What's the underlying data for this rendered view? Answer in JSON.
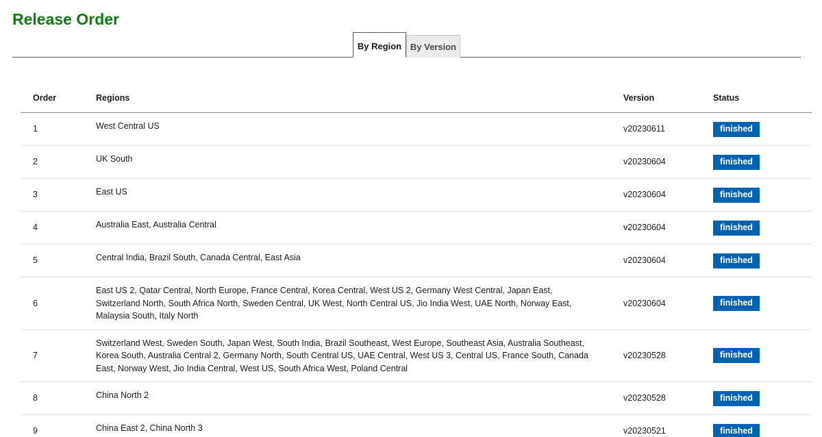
{
  "page": {
    "title": "Release Order"
  },
  "tabs": [
    {
      "label": "By Region",
      "active": true
    },
    {
      "label": "By Version",
      "active": false
    }
  ],
  "table": {
    "headers": {
      "order": "Order",
      "regions": "Regions",
      "version": "Version",
      "status": "Status"
    },
    "rows": [
      {
        "order": "1",
        "regions": "West Central US",
        "version": "v20230611",
        "status": "finished"
      },
      {
        "order": "2",
        "regions": "UK South",
        "version": "v20230604",
        "status": "finished"
      },
      {
        "order": "3",
        "regions": "East US",
        "version": "v20230604",
        "status": "finished"
      },
      {
        "order": "4",
        "regions": "Australia East, Australia Central",
        "version": "v20230604",
        "status": "finished"
      },
      {
        "order": "5",
        "regions": "Central India, Brazil South, Canada Central, East Asia",
        "version": "v20230604",
        "status": "finished"
      },
      {
        "order": "6",
        "regions": "East US 2, Qatar Central, North Europe, France Central, Korea Central, West US 2, Germany West Central, Japan East, Switzerland North, South Africa North, Sweden Central, UK West, North Central US, Jio India West, UAE North, Norway East, Malaysia South, Italy North",
        "version": "v20230604",
        "status": "finished"
      },
      {
        "order": "7",
        "regions": "Switzerland West, Sweden South, Japan West, South India, Brazil Southeast, West Europe, Southeast Asia, Australia Southeast, Korea South, Australia Central 2, Germany North, South Central US, UAE Central, West US 3, Central US, France South, Canada East, Norway West, Jio India Central, West US, South Africa West, Poland Central",
        "version": "v20230528",
        "status": "finished"
      },
      {
        "order": "8",
        "regions": "China North 2",
        "version": "v20230528",
        "status": "finished"
      },
      {
        "order": "9",
        "regions": "China East 2, China North 3",
        "version": "v20230521",
        "status": "finished"
      }
    ]
  },
  "colors": {
    "title": "#107c10",
    "status_badge": "#0063b1"
  }
}
